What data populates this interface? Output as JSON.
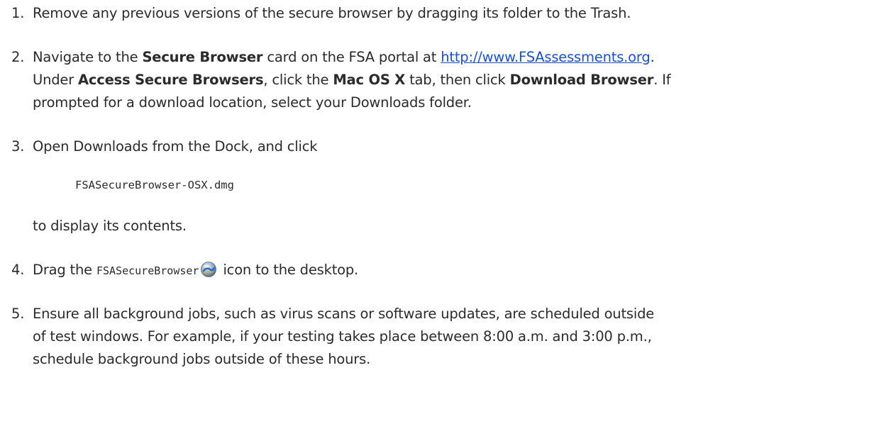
{
  "steps": {
    "s1": {
      "number": "1.",
      "text": "Remove any previous versions of the secure browser by dragging its folder to the Trash."
    },
    "s2": {
      "number": "2.",
      "a": "Navigate to the ",
      "b_secure_browser": "Secure Browser",
      "c": " card on the FSA portal at ",
      "link": "http://www.FSAssessments.org",
      "d": ".",
      "line2_a": "Under ",
      "b_access": "Access Secure Browsers",
      "line2_b": ", click the ",
      "b_mac": "Mac OS X",
      "line2_c": " tab, then click ",
      "b_download": "Download Browser",
      "line2_d": ". If",
      "line3": "prompted for a download location, select your Downloads folder."
    },
    "s3": {
      "number": "3.",
      "text": "Open Downloads from the Dock, and click",
      "code": "FSASecureBrowser-OSX.dmg",
      "after": "to display its contents."
    },
    "s4": {
      "number": "4.",
      "a": "Drag the ",
      "code": "FSASecureBrowser",
      "icon": "fsa-secure-browser-icon",
      "b": " icon to the desktop."
    },
    "s5": {
      "number": "5.",
      "line1": "Ensure all background jobs, such as virus scans or software updates, are scheduled outside",
      "line2": "of test windows. For example, if your testing takes place between 8:00 a.m. and 3:00 p.m.,",
      "line3": "schedule background jobs outside of these hours."
    }
  }
}
